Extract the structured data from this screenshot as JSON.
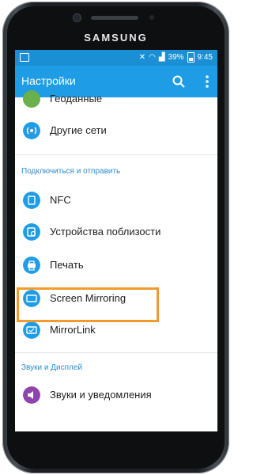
{
  "device": {
    "brand": "SAMSUNG"
  },
  "status_bar": {
    "signal_pct": "39%",
    "time": "9:45"
  },
  "app_bar": {
    "title": "Настройки",
    "search_icon": "search-icon",
    "more_icon": "more-vert-icon"
  },
  "list": {
    "partial_item": {
      "label": "Геоданные",
      "icon": "location-icon",
      "color": "#6ab04c"
    },
    "items_top": [
      {
        "label": "Другие сети",
        "icon": "other-networks-icon",
        "color": "#1f9ce6"
      }
    ],
    "section_connect": {
      "label": "Подключиться и отправить"
    },
    "items_connect": [
      {
        "label": "NFC",
        "icon": "nfc-icon",
        "color": "#1f9ce6"
      },
      {
        "label": "Устройства поблизости",
        "icon": "nearby-devices-icon",
        "color": "#1f9ce6"
      },
      {
        "label": "Печать",
        "icon": "print-icon",
        "color": "#1f9ce6"
      },
      {
        "label": "Screen Mirroring",
        "icon": "screen-mirroring-icon",
        "color": "#1f9ce6"
      },
      {
        "label": "MirrorLink",
        "icon": "mirrorlink-icon",
        "color": "#1f9ce6"
      }
    ],
    "section_sound": {
      "label": "Звуки и Дисплей"
    },
    "items_sound": [
      {
        "label": "Звуки и уведомления",
        "icon": "sound-icon",
        "color": "#8e44ad"
      }
    ]
  },
  "highlight_color": "#f39a2e"
}
